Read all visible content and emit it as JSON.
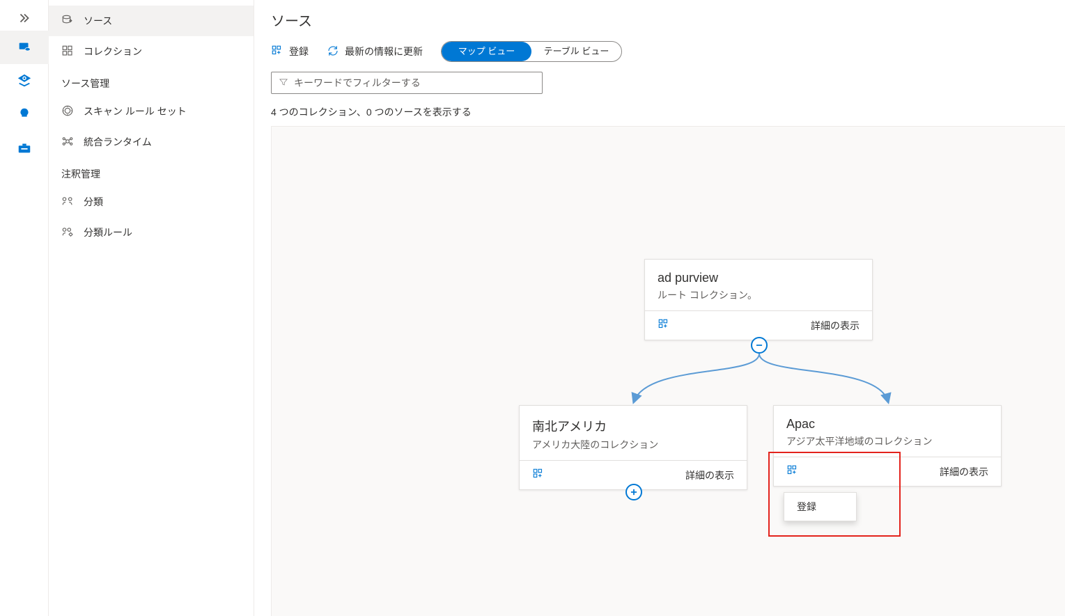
{
  "rail": {},
  "sidebar": {
    "items": {
      "sources": "ソース",
      "collections": "コレクション"
    },
    "section1": "ソース管理",
    "section1_items": {
      "scan_rules": "スキャン ルール セット",
      "integration_runtime": "統合ランタイム"
    },
    "section2": "注釈管理",
    "section2_items": {
      "classification": "分類",
      "classification_rules": "分類ルール"
    }
  },
  "main": {
    "title": "ソース",
    "toolbar": {
      "register": "登録",
      "refresh": "最新の情報に更新",
      "map_view": "マップ ビュー",
      "table_view": "テーブル ビュー"
    },
    "filter_placeholder": "キーワードでフィルターする",
    "status": "4 つのコレクション、0 つのソースを表示する"
  },
  "nodes": {
    "root": {
      "title": "ad purview",
      "subtitle": "ルート コレクション。",
      "detail": "詳細の表示"
    },
    "americas": {
      "title": "南北アメリカ",
      "subtitle": "アメリカ大陸のコレクション",
      "detail": "詳細の表示"
    },
    "apac": {
      "title": "Apac",
      "subtitle": "アジア太平洋地域のコレクション",
      "detail": "詳細の表示"
    }
  },
  "popup": {
    "register": "登録"
  }
}
